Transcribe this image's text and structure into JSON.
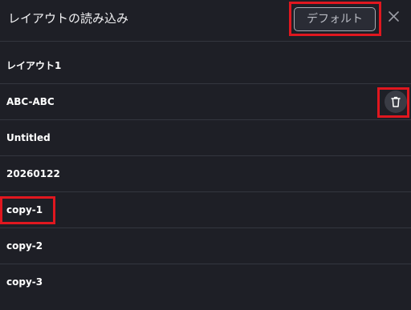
{
  "dialog": {
    "title": "レイアウトの読み込み",
    "default_button_label": "デフォルト",
    "close_icon": "close-icon"
  },
  "layouts": {
    "items": [
      {
        "label": "レイアウト1"
      },
      {
        "label": "ABC-ABC",
        "action_icon": "trash-icon"
      },
      {
        "label": "Untitled"
      },
      {
        "label": "20260122"
      },
      {
        "label": "copy-1"
      },
      {
        "label": "copy-2"
      },
      {
        "label": "copy-3"
      }
    ]
  },
  "colors": {
    "background": "#1e1f26",
    "divider": "#34363f",
    "highlight": "#e0171f",
    "text": "#ffffff",
    "button_border": "#a9abb3"
  }
}
